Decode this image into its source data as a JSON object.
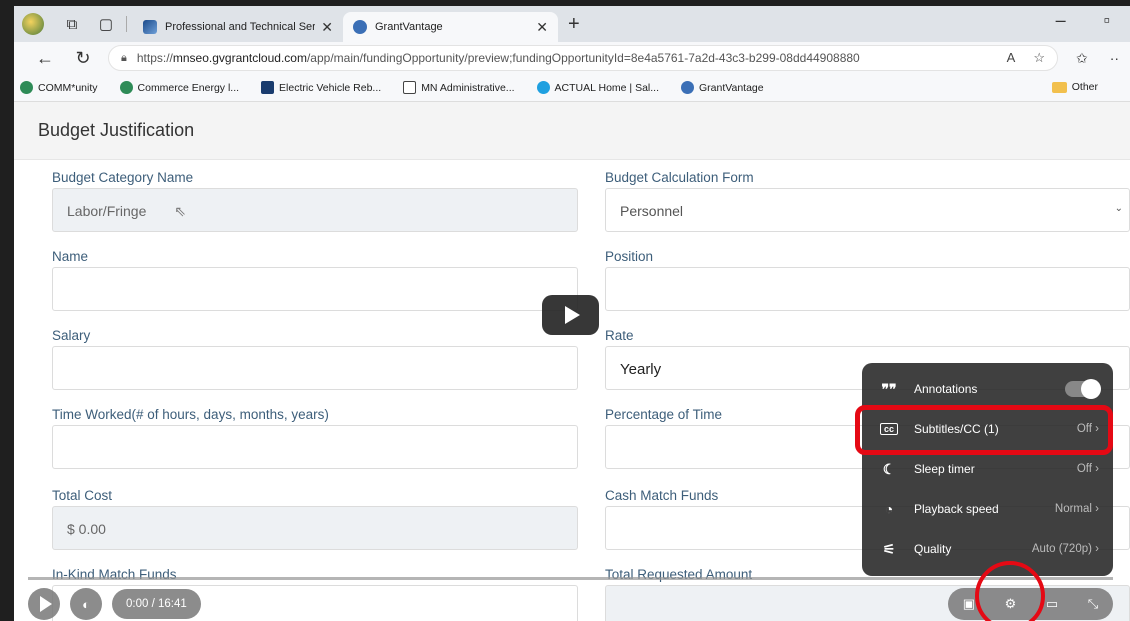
{
  "browser": {
    "tabs": [
      {
        "title": "Professional and Technical Service",
        "active": false
      },
      {
        "title": "GrantVantage",
        "active": true
      }
    ],
    "url": {
      "scheme": "https://",
      "host": "mnseo.gvgrantcloud.com",
      "path": "/app/main/fundingOpportunity/preview;fundingOpportunityId=8e4a5761-7a2d-43c3-b299-08dd44908880"
    },
    "bookmarks": [
      {
        "label": "COMM*unity",
        "icon": "leaf-icon"
      },
      {
        "label": "Commerce Energy l...",
        "icon": "leaf-icon"
      },
      {
        "label": "Electric Vehicle Reb...",
        "icon": "mn-logo-icon"
      },
      {
        "label": "MN Administrative...",
        "icon": "document-icon"
      },
      {
        "label": "ACTUAL Home | Sal...",
        "icon": "cloud-icon"
      },
      {
        "label": "GrantVantage",
        "icon": "gv-logo-icon"
      }
    ],
    "other_bookmarks": "Other"
  },
  "page": {
    "title": "Budget Justification",
    "fields": {
      "budget_category_name": {
        "label": "Budget Category Name",
        "value": "Labor/Fringe"
      },
      "budget_calculation_form": {
        "label": "Budget Calculation Form",
        "value": "Personnel"
      },
      "name": {
        "label": "Name",
        "value": ""
      },
      "position": {
        "label": "Position",
        "value": ""
      },
      "salary": {
        "label": "Salary",
        "value": ""
      },
      "rate": {
        "label": "Rate",
        "value": "Yearly"
      },
      "time_worked": {
        "label": "Time Worked(# of hours, days, months, years)",
        "value": ""
      },
      "percentage_of_time": {
        "label": "Percentage of Time",
        "value": ""
      },
      "total_cost": {
        "label": "Total Cost",
        "value": "$ 0.00"
      },
      "cash_match_funds": {
        "label": "Cash Match Funds",
        "value": ""
      },
      "in_kind_match_funds": {
        "label": "In-Kind Match Funds",
        "value": ""
      },
      "total_requested_amount": {
        "label": "Total Requested Amount",
        "value": ""
      }
    }
  },
  "video": {
    "time": "0:00 / 16:41",
    "settings": [
      {
        "label": "Annotations",
        "value": "",
        "icon": "annotations-icon"
      },
      {
        "label": "Subtitles/CC (1)",
        "value": "Off",
        "icon": "cc-icon"
      },
      {
        "label": "Sleep timer",
        "value": "Off",
        "icon": "sleep-timer-icon"
      },
      {
        "label": "Playback speed",
        "value": "Normal",
        "icon": "playback-speed-icon"
      },
      {
        "label": "Quality",
        "value": "Auto (720p)",
        "icon": "quality-icon"
      }
    ],
    "annotation_color": "#e50914"
  }
}
